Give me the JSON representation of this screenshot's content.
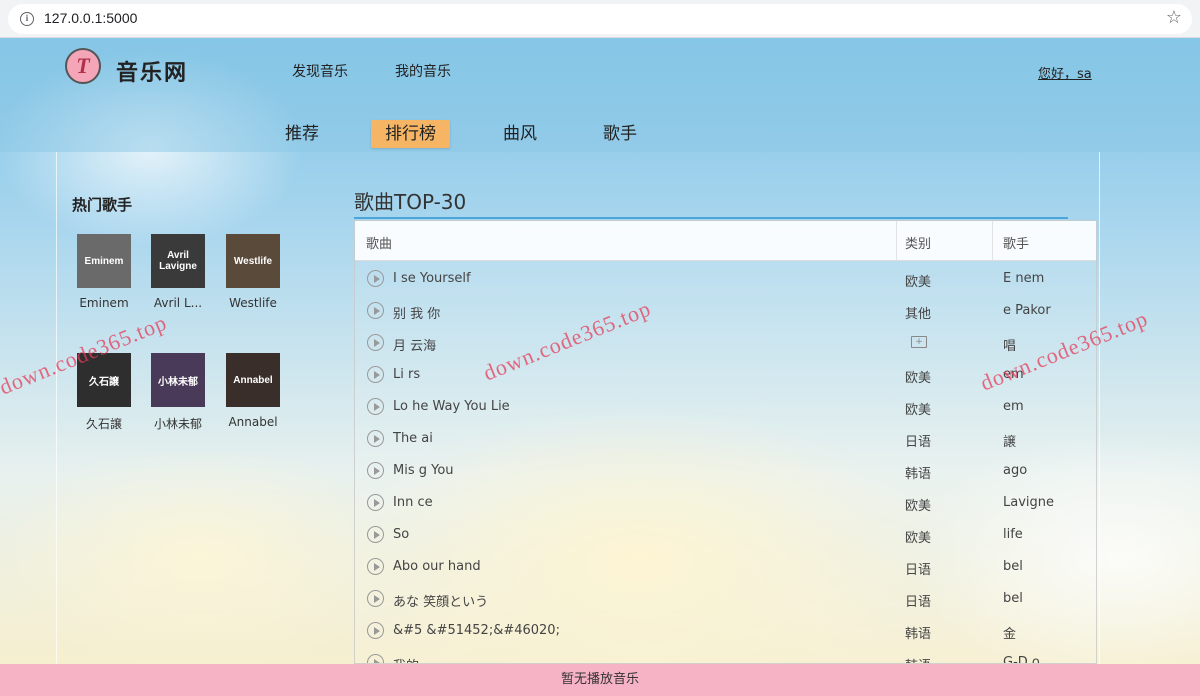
{
  "browser": {
    "url": "127.0.0.1:5000",
    "info_icon": "i",
    "star_icon": "☆"
  },
  "header": {
    "logo_letter": "T",
    "site_name": "音乐网",
    "nav": [
      "发现音乐",
      "我的音乐"
    ],
    "greeting": "您好，sa"
  },
  "subnav": {
    "items": [
      "推荐",
      "排行榜",
      "曲风",
      "歌手"
    ],
    "active": "排行榜"
  },
  "hot_artists": {
    "title": "热门歌手",
    "items": [
      {
        "name": "Eminem",
        "img_text": "Eminem",
        "color": "#6a6a6a"
      },
      {
        "name": "Avril L...",
        "img_text": "Avril Lavigne",
        "color": "#3a3a3a"
      },
      {
        "name": "Westlife",
        "img_text": "Westlife",
        "color": "#5a4a3a"
      },
      {
        "name": "久石譲",
        "img_text": "久石譲",
        "color": "#2e2e2e"
      },
      {
        "name": "小林未郁",
        "img_text": "小林未郁",
        "color": "#4a3a5a"
      },
      {
        "name": "Annabel",
        "img_text": "Annabel",
        "color": "#3a2e2a"
      }
    ]
  },
  "song_list": {
    "title": "歌曲TOP-30",
    "columns": [
      "歌曲",
      "类别",
      "歌手"
    ],
    "rows": [
      {
        "song": "I  se Yourself",
        "category": "欧美",
        "singer": "E     nem"
      },
      {
        "song": "别    我    你",
        "category": "其他",
        "singer": "       e Pakor"
      },
      {
        "song": "月       云海",
        "category": "",
        "singer": "         唱"
      },
      {
        "song": "Li       rs",
        "category": "欧美",
        "singer": "        em"
      },
      {
        "song": "Lo      he Way You Lie",
        "category": "欧美",
        "singer": "        em"
      },
      {
        "song": "The      ai",
        "category": "日语",
        "singer": "         譲"
      },
      {
        "song": "Mis     g You",
        "category": "韩语",
        "singer": "        ago"
      },
      {
        "song": "Inn        ce",
        "category": "欧美",
        "singer": "        Lavigne"
      },
      {
        "song": "So        ",
        "category": "欧美",
        "singer": "        life"
      },
      {
        "song": "Abo      our hand",
        "category": "日语",
        "singer": "       bel"
      },
      {
        "song": "あな      笑顔という",
        "category": "日语",
        "singer": "       bel"
      },
      {
        "song": "&#5      &#51452;&#46020;",
        "category": "韩语",
        "singer": "金      "
      },
      {
        "song": "我的      ",
        "category": "韩语",
        "singer": "G-D     o"
      }
    ]
  },
  "watermarks": [
    "down.code365.top",
    "down.code365.top",
    "down.code365.top"
  ],
  "player": {
    "status": "暂无播放音乐"
  }
}
